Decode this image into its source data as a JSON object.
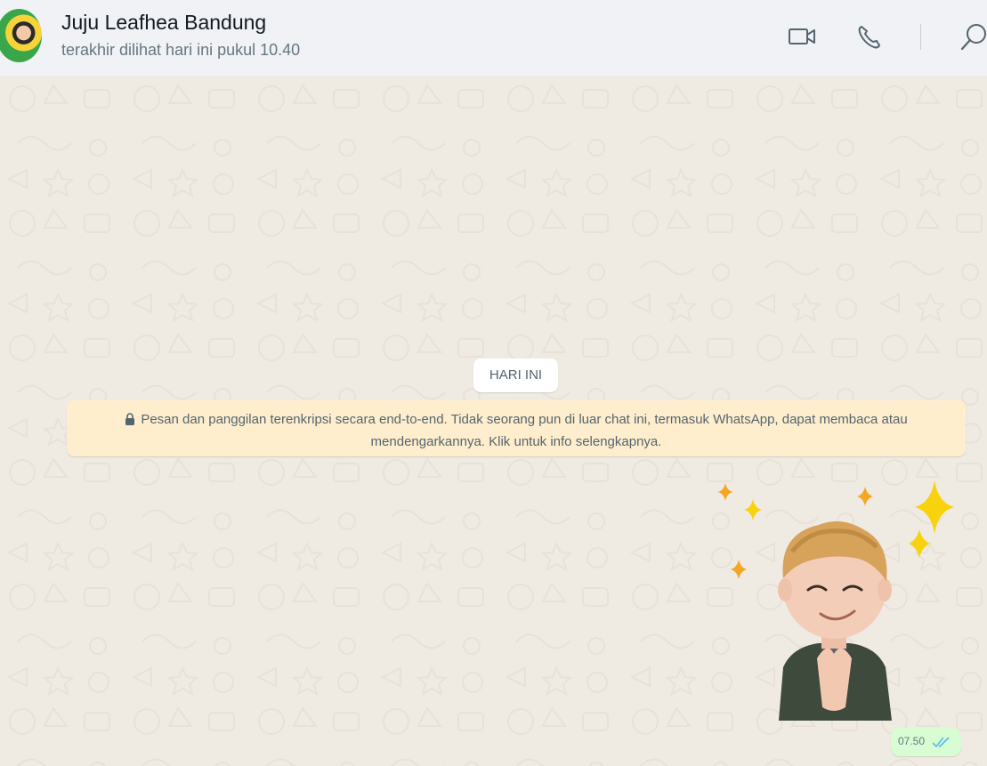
{
  "header": {
    "contact_name": "Juju Leafhea Bandung",
    "last_seen": "terakhir dilihat hari ini pukul 10.40",
    "icons": [
      "video-call-icon",
      "voice-call-icon",
      "search-icon"
    ]
  },
  "chat": {
    "date_separator": "HARI INI",
    "encryption_notice": "Pesan dan panggilan terenkripsi secara end-to-end. Tidak seorang pun di luar chat ini, termasuk WhatsApp, dapat membaca atau mendengarkannya. Klik untuk info selengkapnya.",
    "message": {
      "type": "sticker",
      "time": "07.50",
      "status": "read"
    }
  },
  "colors": {
    "header_bg": "#f0f2f5",
    "chat_bg": "#efeae2",
    "notice_bg": "#ffeecd",
    "outgoing_bg": "#d9fdd3",
    "read_tick": "#53bdeb"
  }
}
